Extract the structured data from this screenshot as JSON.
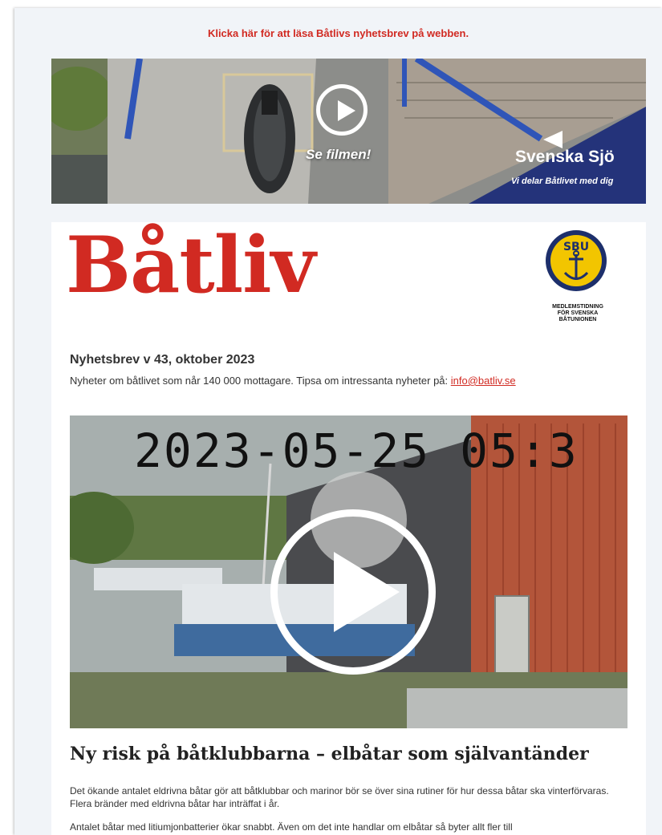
{
  "header": {
    "web_link": "Klicka här för att läsa Båtlivs nyhetsbrev på webben."
  },
  "banner": {
    "cta_label": "Se filmen!",
    "brand_name": "Svenska Sjö",
    "brand_tagline": "Vi delar Båtlivet med dig",
    "brand_color": "#24337a"
  },
  "masthead": {
    "logo_text": "Båtliv",
    "logo_color": "#d12a22",
    "badge_text": "SBU",
    "badge_caption": [
      "MEDLEMSTIDNING",
      "FÖR SVENSKA",
      "BÅTUNIONEN"
    ]
  },
  "newsletter": {
    "issue_title": "Nyhetsbrev v 43, oktober 2023",
    "intro_text": "Nyheter om båtlivet som når 140 000 mottagare. Tipsa om intressanta nyheter på: ",
    "email_link": "info@batliv.se"
  },
  "article": {
    "video_timestamp": "2023-05-25 05:3",
    "headline": "Ny risk på båtklubbarna – elbåtar som självantänder",
    "paragraph_1": "Det ökande antalet eldrivna båtar gör att båtklubbar och marinor bör se över sina rutiner för hur dessa båtar ska vinterförvaras. Flera bränder med eldrivna båtar har inträffat i år.",
    "paragraph_2": "Antalet båtar med litiumjonbatterier ökar snabbt. Även om det inte handlar om elbåtar så byter allt fler till"
  }
}
